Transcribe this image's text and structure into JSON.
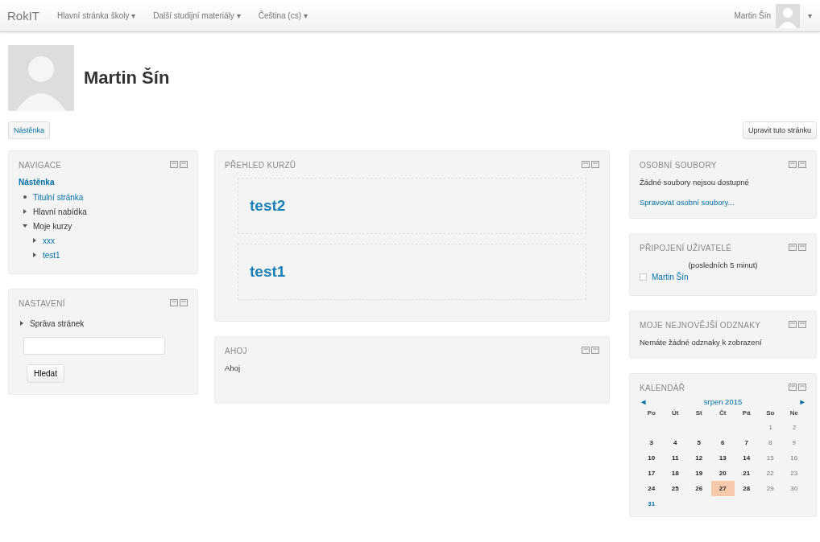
{
  "navbar": {
    "brand": "RokIT",
    "menus": [
      {
        "label": "Hlavní stránka školy",
        "caret": "▾"
      },
      {
        "label": "Další studijní materiály",
        "caret": "▾"
      },
      {
        "label": "Čeština (cs)",
        "caret": "▾"
      }
    ],
    "user": {
      "name": "Martin Šín",
      "caret": "▾"
    }
  },
  "profile": {
    "name": "Martin Šín"
  },
  "buttons": {
    "left": "Nástěnka",
    "right": "Upravit tuto stránku"
  },
  "navigation": {
    "title": "NAVIGACE",
    "root": "Nástěnka",
    "items": [
      {
        "label": "Titulní stránka",
        "kind": "leaf",
        "link": true
      },
      {
        "label": "Hlavní nabídka",
        "kind": "branch",
        "expanded": false,
        "link": false
      },
      {
        "label": "Moje kurzy",
        "kind": "branch",
        "expanded": true,
        "link": false,
        "children": [
          {
            "label": "xxx",
            "kind": "branch",
            "expanded": false,
            "link": true
          },
          {
            "label": "test1",
            "kind": "branch",
            "expanded": false,
            "link": true
          }
        ]
      }
    ]
  },
  "settings": {
    "title": "NASTAVENÍ",
    "item": {
      "label": "Správa stránek",
      "kind": "branch",
      "expanded": false
    },
    "search_button": "Hledat"
  },
  "course_overview": {
    "title": "PŘEHLED KURZŮ",
    "courses": [
      "test2",
      "test1"
    ]
  },
  "html_block": {
    "title": "AHOJ",
    "text": "Ahoj"
  },
  "private_files": {
    "title": "OSOBNÍ SOUBORY",
    "text": "Žádné soubory nejsou dostupné",
    "link": "Spravovat osobní soubory..."
  },
  "online_users": {
    "title": "PŘIPOJENÍ UŽIVATELÉ",
    "period": "(posledních 5 minut)",
    "users": [
      "Martin Šín"
    ]
  },
  "badges": {
    "title": "MOJE NEJNOVĚJŠÍ ODZNAKY",
    "text": "Nemáte žádné odznaky k zobrazení"
  },
  "calendar": {
    "title": "KALENDÁŘ",
    "prev": "◄",
    "month": "srpen 2015",
    "next": "►",
    "weekdays": [
      "Po",
      "Út",
      "St",
      "Čt",
      "Pá",
      "So",
      "Ne"
    ],
    "weeks": [
      {
        "right_aligned": true,
        "days": [
          {
            "day": "1",
            "weekend": true,
            "today": false,
            "link": false
          },
          {
            "day": "2",
            "weekend": true,
            "today": false,
            "link": false
          }
        ]
      },
      {
        "right_aligned": false,
        "days": [
          {
            "day": "3",
            "weekend": false,
            "today": false,
            "link": false
          },
          {
            "day": "4",
            "weekend": false,
            "today": false,
            "link": false
          },
          {
            "day": "5",
            "weekend": false,
            "today": false,
            "link": false
          },
          {
            "day": "6",
            "weekend": false,
            "today": false,
            "link": false
          },
          {
            "day": "7",
            "weekend": false,
            "today": false,
            "link": false
          },
          {
            "day": "8",
            "weekend": true,
            "today": false,
            "link": false
          },
          {
            "day": "9",
            "weekend": true,
            "today": false,
            "link": false
          }
        ]
      },
      {
        "right_aligned": false,
        "days": [
          {
            "day": "10",
            "weekend": false,
            "today": false,
            "link": false
          },
          {
            "day": "11",
            "weekend": false,
            "today": false,
            "link": false
          },
          {
            "day": "12",
            "weekend": false,
            "today": false,
            "link": false
          },
          {
            "day": "13",
            "weekend": false,
            "today": false,
            "link": false
          },
          {
            "day": "14",
            "weekend": false,
            "today": false,
            "link": false
          },
          {
            "day": "15",
            "weekend": true,
            "today": false,
            "link": false
          },
          {
            "day": "16",
            "weekend": true,
            "today": false,
            "link": false
          }
        ]
      },
      {
        "right_aligned": false,
        "days": [
          {
            "day": "17",
            "weekend": false,
            "today": false,
            "link": false
          },
          {
            "day": "18",
            "weekend": false,
            "today": false,
            "link": false
          },
          {
            "day": "19",
            "weekend": false,
            "today": false,
            "link": false
          },
          {
            "day": "20",
            "weekend": false,
            "today": false,
            "link": false
          },
          {
            "day": "21",
            "weekend": false,
            "today": false,
            "link": false
          },
          {
            "day": "22",
            "weekend": true,
            "today": false,
            "link": false
          },
          {
            "day": "23",
            "weekend": true,
            "today": false,
            "link": false
          }
        ]
      },
      {
        "right_aligned": false,
        "days": [
          {
            "day": "24",
            "weekend": false,
            "today": false,
            "link": false
          },
          {
            "day": "25",
            "weekend": false,
            "today": false,
            "link": false
          },
          {
            "day": "26",
            "weekend": false,
            "today": false,
            "link": false
          },
          {
            "day": "27",
            "weekend": false,
            "today": true,
            "link": false
          },
          {
            "day": "28",
            "weekend": false,
            "today": false,
            "link": false
          },
          {
            "day": "29",
            "weekend": true,
            "today": false,
            "link": false
          },
          {
            "day": "30",
            "weekend": true,
            "today": false,
            "link": false
          }
        ]
      },
      {
        "right_aligned": false,
        "days": [
          {
            "day": "31",
            "weekend": false,
            "today": false,
            "link": true
          }
        ]
      }
    ]
  }
}
